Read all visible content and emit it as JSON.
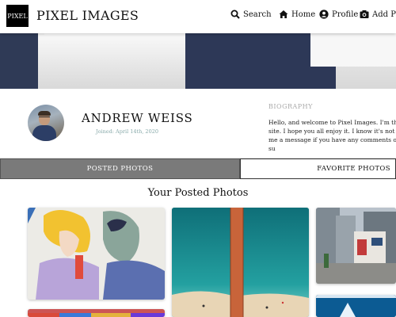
{
  "navbar": {
    "logo_text": "PIXEL",
    "brand": "PIXEL IMAGES",
    "items": [
      {
        "label": "Search",
        "icon": "search-icon"
      },
      {
        "label": "Home",
        "icon": "home-icon"
      },
      {
        "label": "Profile",
        "icon": "user-circle-icon"
      },
      {
        "label": "Add Ph",
        "icon": "camera-icon"
      }
    ]
  },
  "profile": {
    "name": "ANDREW WEISS",
    "joined": "Joined: April 14th, 2020",
    "bio_title": "BIOGRAPHY",
    "bio_lines": [
      "Hello, and welcome to Pixel Images. I'm the c",
      "site. I hope you all enjoy it. I know it's not per",
      "me a message if you have any comments or su"
    ]
  },
  "tabs": {
    "posted": "POSTED PHOTOS",
    "favorite": "FAVORITE PHOTOS"
  },
  "section_title": "Your Posted Photos",
  "colors": {
    "active_tab": "#7a7a7a",
    "logo_bg": "#000000"
  }
}
